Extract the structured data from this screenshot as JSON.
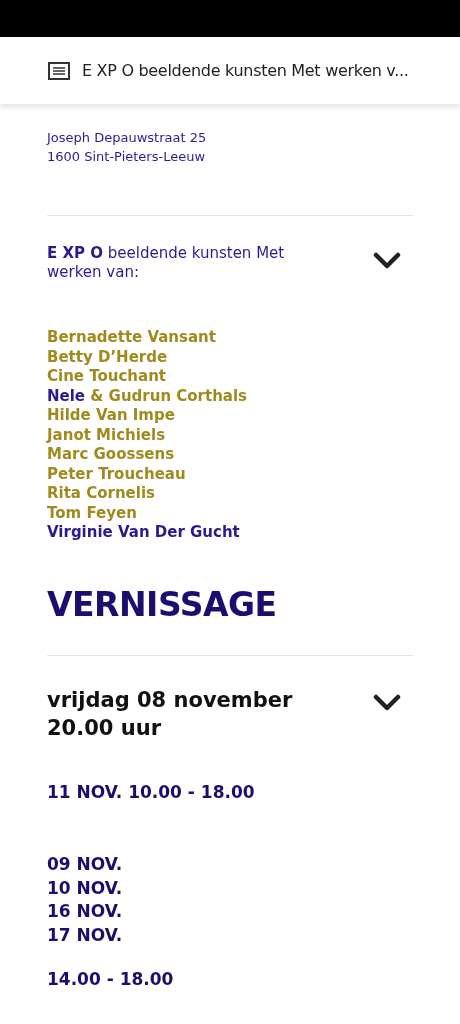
{
  "top_bar": {
    "title": "E XP O beeldende kunsten Met werken v..."
  },
  "address": [
    "Joseph Depauwstraat 25",
    "1600 Sint-Pieters-Leeuw"
  ],
  "expo_section": {
    "heading": "**E XP O** beeldende kunsten Met werken van:",
    "expanded": true
  },
  "artists": [
    {
      "parts": [
        {
          "text": "Bernadette Vansant",
          "color": "#a08a1e"
        }
      ]
    },
    {
      "parts": [
        {
          "text": "Betty D’Herde",
          "color": "#a08a1e"
        }
      ]
    },
    {
      "parts": [
        {
          "text": "Cine Touchant",
          "color": "#a08a1e"
        }
      ]
    },
    {
      "parts": [
        {
          "text": "Nele",
          "color": "#2b1c8e"
        },
        {
          "text": "& Gudrun Corthals",
          "color": "#a08a1e"
        }
      ]
    },
    {
      "parts": [
        {
          "text": "Hilde Van Impe",
          "color": "#a08a1e"
        }
      ]
    },
    {
      "parts": [
        {
          "text": "Janot Michiels",
          "color": "#a08a1e"
        }
      ]
    },
    {
      "parts": [
        {
          "text": "Marc Goossens",
          "color": "#a08a1e"
        }
      ]
    },
    {
      "parts": [
        {
          "text": "Peter Troucheau",
          "color": "#a08a1e"
        }
      ]
    },
    {
      "parts": [
        {
          "text": "Rita Cornelis",
          "color": "#a08a1e"
        }
      ]
    },
    {
      "parts": [
        {
          "text": "Tom Feyen",
          "color": "#a08a1e"
        }
      ]
    },
    {
      "parts": [
        {
          "text": "Virginie Van Der Gucht",
          "color": "#2b1c8e"
        }
      ]
    }
  ],
  "vernissage": {
    "title": "VERNISSAGE",
    "date_lines": [
      "vrijdag 08 november",
      "20.00 uur"
    ],
    "expanded": true
  },
  "opening_hours": {
    "first": "11 NOV. 10.00 - 18.00",
    "dates": [
      "09 NOV.",
      "10 NOV.",
      "16 NOV.",
      "17 NOV."
    ],
    "hours": "14.00 - 18.00"
  }
}
